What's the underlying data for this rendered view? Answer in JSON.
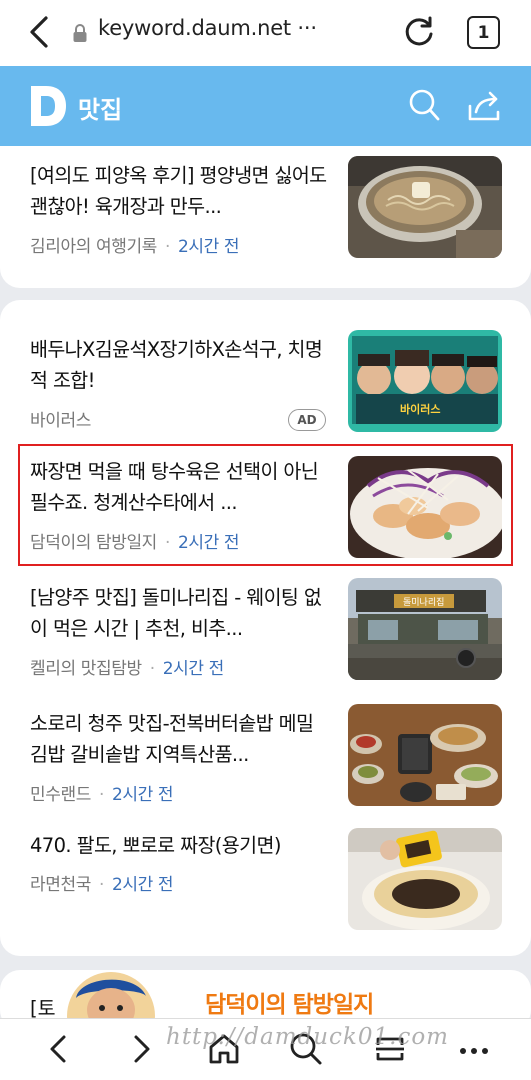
{
  "browser": {
    "url": "keyword.daum.net ···",
    "tab_count": "1"
  },
  "header": {
    "logo_letter": "D",
    "title": "맛집"
  },
  "card1": {
    "items": [
      {
        "title": "[여의도 피양옥 후기] 평양냉면 싫어도 괜찮아! 육개장과 만두...",
        "author": "김리아의 여행기록",
        "time": "2시간 전",
        "image": "naengmyeon-bowl"
      }
    ]
  },
  "card2": {
    "items": [
      {
        "title": "배두나X김윤석X장기하X손석구, 치명적 조합!",
        "author": "바이러스",
        "badge": "AD",
        "image": "movie-poster",
        "poster_text": "바이러스"
      },
      {
        "title": "짜장면 먹을 때 탕수육은 선택이 아닌 필수죠. 청계산수타에서 ...",
        "author": "담덕이의 탐방일지",
        "time": "2시간 전",
        "image": "tangsuyuk-plate",
        "highlighted": true
      },
      {
        "title": "[남양주 맛집] 돌미나리집 - 웨이팅 없이 먹은 시간 | 추천, 비추...",
        "author": "켈리의 맛집탐방",
        "time": "2시간 전",
        "image": "restaurant-exterior",
        "sign_text": "돌미나리집"
      },
      {
        "title": "소로리 청주 맛집-전복버터솥밥 메밀김밥 갈비솥밥 지역특산품...",
        "author": "민수랜드",
        "time": "2시간 전",
        "image": "korean-table-set"
      },
      {
        "title": "470. 팔도, 뽀로로 짜장(용기면)",
        "author": "라면천국",
        "time": "2시간 전",
        "image": "jjajang-cup-noodle"
      }
    ]
  },
  "card3": {
    "partial_title": "[토"
  },
  "watermark": {
    "blog_name": "담덕이의 탐방일지",
    "url": "http://damduck01.com"
  },
  "bottom_nav": [
    "back-icon",
    "forward-icon",
    "home-icon",
    "search-icon",
    "tabs-icon",
    "more-icon"
  ],
  "colors": {
    "header_bg": "#68b9ee",
    "time_text": "#3a6fb8",
    "highlight_border": "#e02020"
  }
}
